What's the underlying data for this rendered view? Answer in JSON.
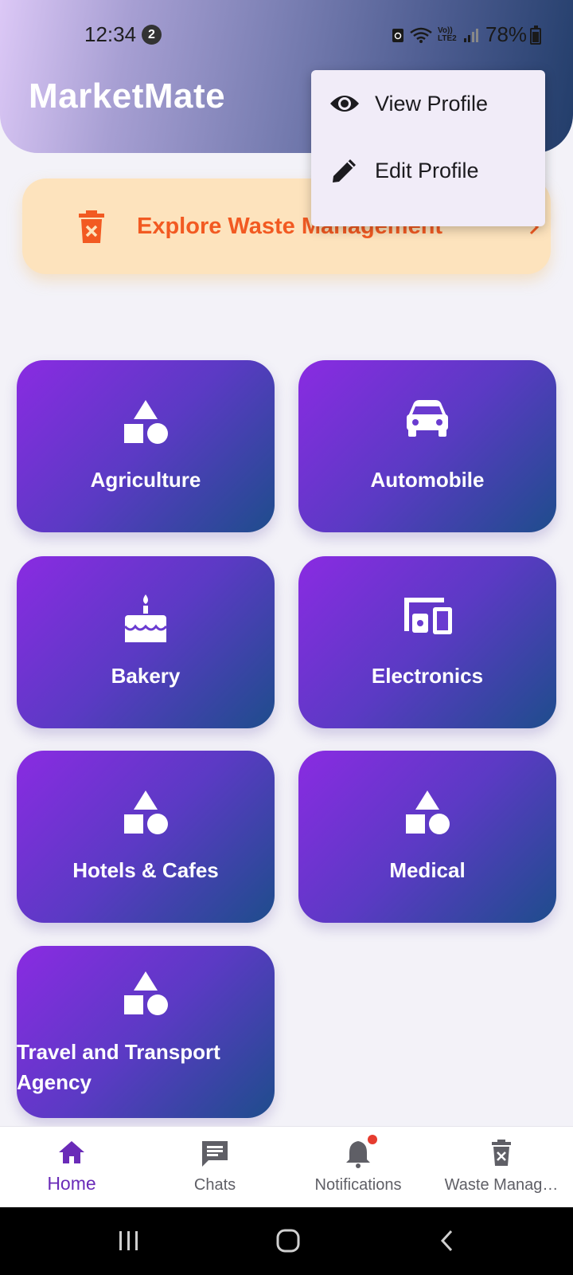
{
  "status_bar": {
    "time": "12:34",
    "notification_count": "2",
    "network_label": "Vo)) LTE2",
    "battery": "78%"
  },
  "header": {
    "title": "MarketMate"
  },
  "popup_menu": {
    "items": [
      {
        "label": "View Profile",
        "icon": "eye-icon"
      },
      {
        "label": "Edit Profile",
        "icon": "pencil-icon"
      }
    ]
  },
  "banner": {
    "label": "Explore Waste Management",
    "icon": "trash-icon",
    "color": "#f25a22",
    "background": "#fde3bd"
  },
  "categories": [
    {
      "label": "Agriculture",
      "icon": "shapes-icon"
    },
    {
      "label": "Automobile",
      "icon": "car-icon"
    },
    {
      "label": "Bakery",
      "icon": "cake-icon"
    },
    {
      "label": "Electronics",
      "icon": "devices-icon"
    },
    {
      "label": "Hotels & Cafes",
      "icon": "shapes-icon"
    },
    {
      "label": "Medical",
      "icon": "shapes-icon"
    },
    {
      "label": "Travel and Transport Agency",
      "icon": "shapes-icon"
    }
  ],
  "bottom_nav": {
    "items": [
      {
        "label": "Home",
        "icon": "home-icon",
        "active": true
      },
      {
        "label": "Chats",
        "icon": "chat-icon",
        "active": false
      },
      {
        "label": "Notifications",
        "icon": "bell-icon",
        "active": false
      },
      {
        "label": "Waste Manag…",
        "icon": "trash-icon",
        "active": false
      }
    ],
    "accent": "#6a2bb8"
  },
  "colors": {
    "card_gradient_start": "#8a2be2",
    "card_gradient_end": "#1e4d8c",
    "page_background": "#f3f2f8"
  }
}
